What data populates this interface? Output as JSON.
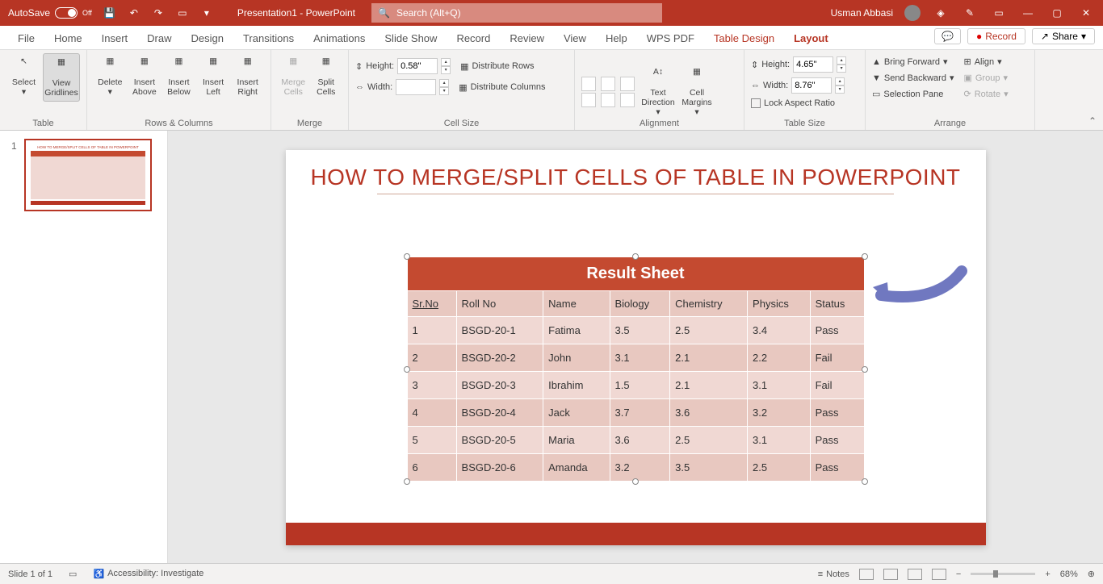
{
  "titlebar": {
    "autosave_label": "AutoSave",
    "autosave_state": "Off",
    "doc_title": "Presentation1 - PowerPoint",
    "search_placeholder": "Search (Alt+Q)",
    "user": "Usman Abbasi"
  },
  "tabs": [
    "File",
    "Home",
    "Insert",
    "Draw",
    "Design",
    "Transitions",
    "Animations",
    "Slide Show",
    "Record",
    "Review",
    "View",
    "Help",
    "WPS PDF",
    "Table Design",
    "Layout"
  ],
  "tabs_right": {
    "record": "Record",
    "share": "Share"
  },
  "ribbon": {
    "table": {
      "select": "Select",
      "view_gridlines": "View Gridlines",
      "label": "Table"
    },
    "rows_cols": {
      "delete": "Delete",
      "insert_above": "Insert Above",
      "insert_below": "Insert Below",
      "insert_left": "Insert Left",
      "insert_right": "Insert Right",
      "label": "Rows & Columns"
    },
    "merge": {
      "merge_cells": "Merge Cells",
      "split_cells": "Split Cells",
      "label": "Merge"
    },
    "cell_size": {
      "height_label": "Height:",
      "height_val": "0.58\"",
      "width_label": "Width:",
      "width_val": "",
      "dist_rows": "Distribute Rows",
      "dist_cols": "Distribute Columns",
      "label": "Cell Size"
    },
    "alignment": {
      "text_dir": "Text Direction",
      "cell_margins": "Cell Margins",
      "label": "Alignment"
    },
    "table_size": {
      "height_label": "Height:",
      "height_val": "4.65\"",
      "width_label": "Width:",
      "width_val": "8.76\"",
      "lock": "Lock Aspect Ratio",
      "label": "Table Size"
    },
    "arrange": {
      "bring_fwd": "Bring Forward",
      "send_back": "Send Backward",
      "sel_pane": "Selection Pane",
      "align": "Align",
      "group": "Group",
      "rotate": "Rotate",
      "label": "Arrange"
    }
  },
  "slide": {
    "number": "1",
    "title": "HOW TO MERGE/SPLIT CELLS OF TABLE IN POWERPOINT",
    "table_title": "Result  Sheet",
    "headers": [
      "Sr.No",
      "Roll No",
      "Name",
      "Biology",
      "Chemistry",
      "Physics",
      "Status"
    ],
    "rows": [
      [
        "1",
        "BSGD-20-1",
        "Fatima",
        "3.5",
        "2.5",
        "3.4",
        "Pass"
      ],
      [
        "2",
        "BSGD-20-2",
        "John",
        "3.1",
        "2.1",
        "2.2",
        "Fail"
      ],
      [
        "3",
        "BSGD-20-3",
        "Ibrahim",
        "1.5",
        "2.1",
        "3.1",
        "Fail"
      ],
      [
        "4",
        "BSGD-20-4",
        "Jack",
        "3.7",
        "3.6",
        "3.2",
        "Pass"
      ],
      [
        "5",
        "BSGD-20-5",
        "Maria",
        "3.6",
        "2.5",
        "3.1",
        "Pass"
      ],
      [
        "6",
        "BSGD-20-6",
        "Amanda",
        "3.2",
        "3.5",
        "2.5",
        "Pass"
      ]
    ]
  },
  "statusbar": {
    "slide": "Slide 1 of 1",
    "access": "Accessibility: Investigate",
    "notes": "Notes",
    "zoom": "68%"
  }
}
